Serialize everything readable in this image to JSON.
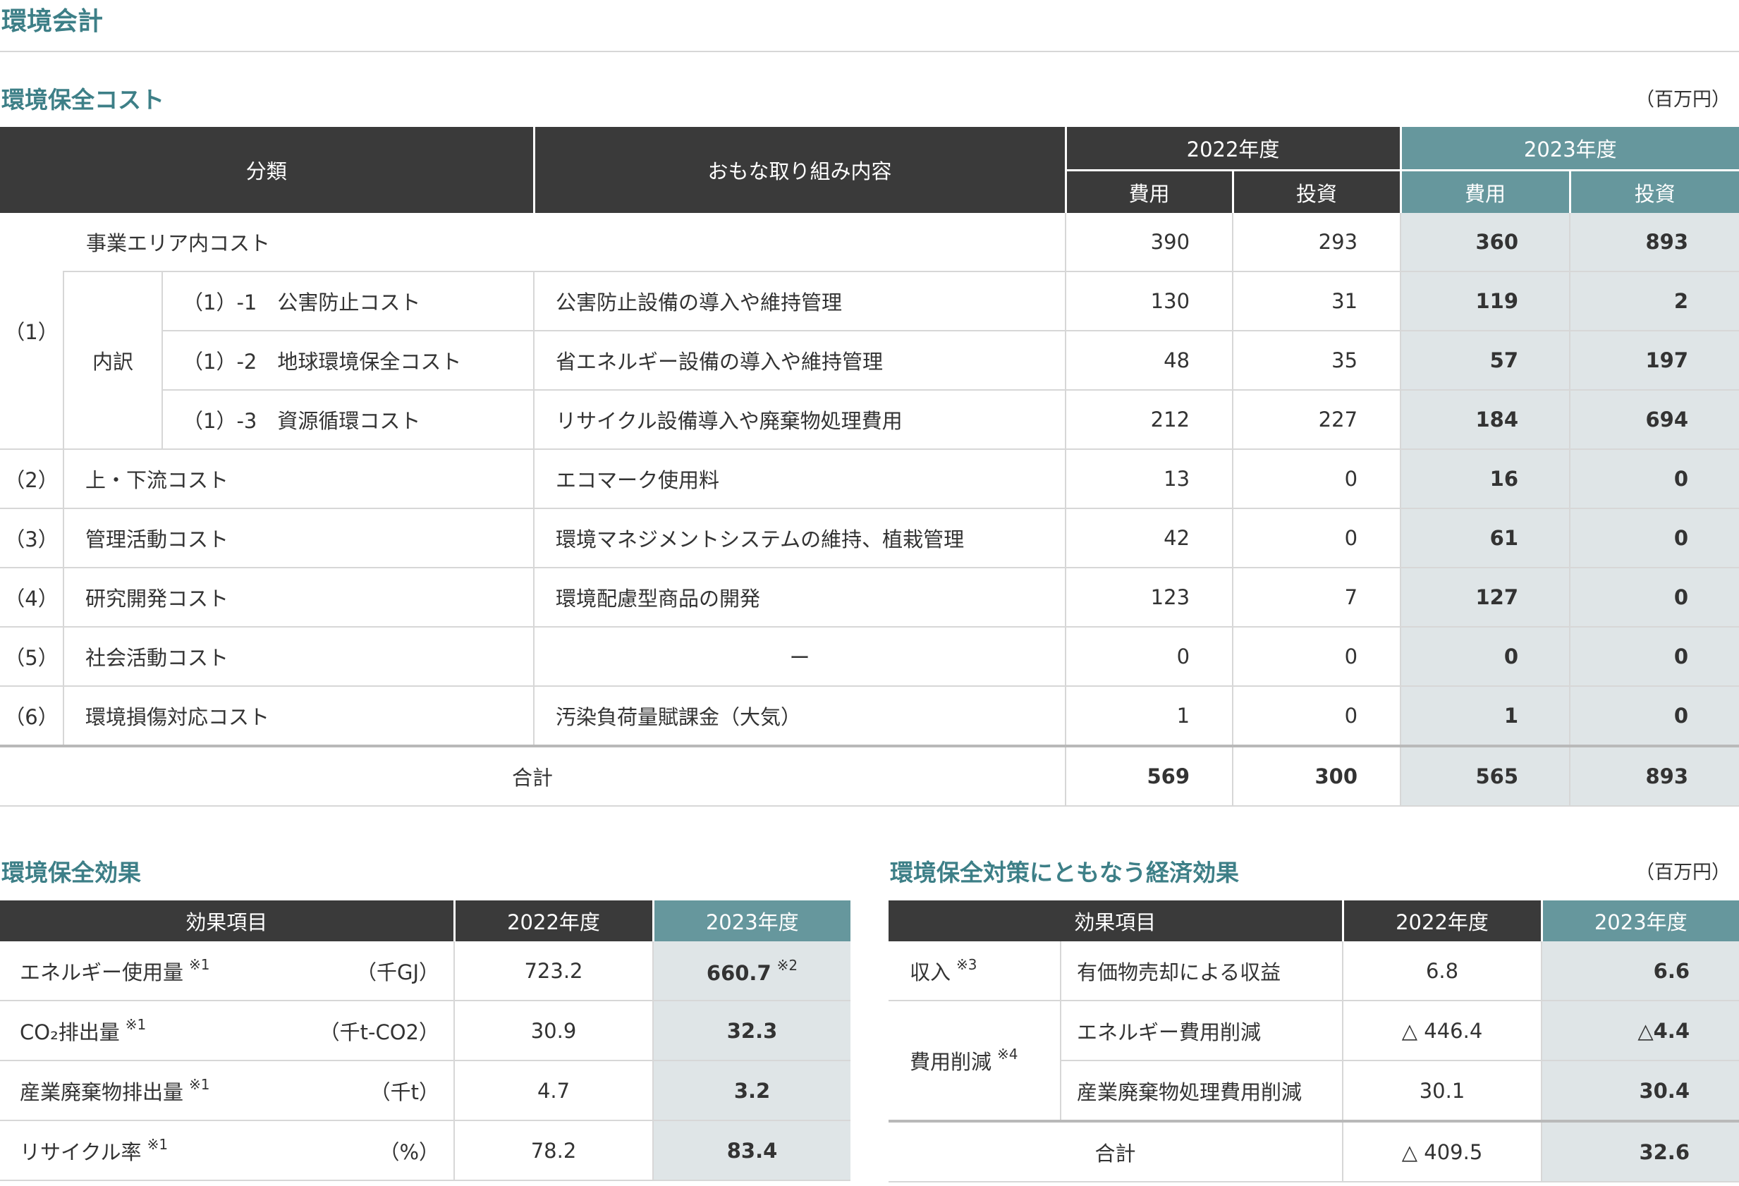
{
  "page_title": "環境会計",
  "cost_section": {
    "title": "環境保全コスト",
    "unit": "（百万円）",
    "headers": {
      "category": "分類",
      "initiatives": "おもな取り組み内容",
      "year2022": "2022年度",
      "year2023": "2023年度",
      "expense": "費用",
      "investment": "投資"
    },
    "rows": {
      "r1": {
        "no": "（1）",
        "label": "事業エリア内コスト",
        "c22": "390",
        "i22": "293",
        "c23": "360",
        "i23": "893"
      },
      "breakdown_label": "内訳",
      "r1_1": {
        "label": "（1）-1　公害防止コスト",
        "desc": "公害防止設備の導入や維持管理",
        "c22": "130",
        "i22": "31",
        "c23": "119",
        "i23": "2"
      },
      "r1_2": {
        "label": "（1）-2　地球環境保全コスト",
        "desc": "省エネルギー設備の導入や維持管理",
        "c22": "48",
        "i22": "35",
        "c23": "57",
        "i23": "197"
      },
      "r1_3": {
        "label": "（1）-3　資源循環コスト",
        "desc": "リサイクル設備導入や廃棄物処理費用",
        "c22": "212",
        "i22": "227",
        "c23": "184",
        "i23": "694"
      },
      "r2": {
        "no": "（2）",
        "label": "上・下流コスト",
        "desc": "エコマーク使用料",
        "c22": "13",
        "i22": "0",
        "c23": "16",
        "i23": "0"
      },
      "r3": {
        "no": "（3）",
        "label": "管理活動コスト",
        "desc": "環境マネジメントシステムの維持、植栽管理",
        "c22": "42",
        "i22": "0",
        "c23": "61",
        "i23": "0"
      },
      "r4": {
        "no": "（4）",
        "label": "研究開発コスト",
        "desc": "環境配慮型商品の開発",
        "c22": "123",
        "i22": "7",
        "c23": "127",
        "i23": "0"
      },
      "r5": {
        "no": "（5）",
        "label": "社会活動コスト",
        "desc": "ー",
        "c22": "0",
        "i22": "0",
        "c23": "0",
        "i23": "0"
      },
      "r6": {
        "no": "（6）",
        "label": "環境損傷対応コスト",
        "desc": "汚染負荷量賦課金（大気）",
        "c22": "1",
        "i22": "0",
        "c23": "1",
        "i23": "0"
      },
      "total": {
        "label": "合計",
        "c22": "569",
        "i22": "300",
        "c23": "565",
        "i23": "893"
      }
    }
  },
  "effect_section": {
    "title": "環境保全効果",
    "headers": {
      "item": "効果項目",
      "year2022": "2022年度",
      "year2023": "2023年度"
    },
    "rows": [
      {
        "item": "エネルギー使用量",
        "note": "※1",
        "unit": "（千GJ）",
        "v22": "723.2",
        "v23": "660.7",
        "v23_note": "※2"
      },
      {
        "item": "CO₂排出量",
        "note": "※1",
        "unit": "（千t-CO2）",
        "v22": "30.9",
        "v23": "32.3"
      },
      {
        "item": "産業廃棄物排出量",
        "note": "※1",
        "unit": "（千t）",
        "v22": "4.7",
        "v23": "3.2"
      },
      {
        "item": "リサイクル率",
        "note": "※1",
        "unit": "（%）",
        "v22": "78.2",
        "v23": "83.4"
      }
    ]
  },
  "econ_section": {
    "title": "環境保全対策にともなう経済効果",
    "unit": "（百万円）",
    "headers": {
      "item": "効果項目",
      "year2022": "2022年度",
      "year2023": "2023年度"
    },
    "income": {
      "label": "収入",
      "note": "※3",
      "detail": "有価物売却による収益",
      "v22": "6.8",
      "v23": "6.6"
    },
    "reduction": {
      "label": "費用削減",
      "note": "※4"
    },
    "reduction_rows": [
      {
        "detail": "エネルギー費用削減",
        "v22": "△ 446.4",
        "v23": "△4.4"
      },
      {
        "detail": "産業廃棄物処理費用削減",
        "v22": "30.1",
        "v23": "30.4"
      }
    ],
    "total": {
      "label": "合計",
      "v22": "△ 409.5",
      "v23": "32.6"
    }
  }
}
